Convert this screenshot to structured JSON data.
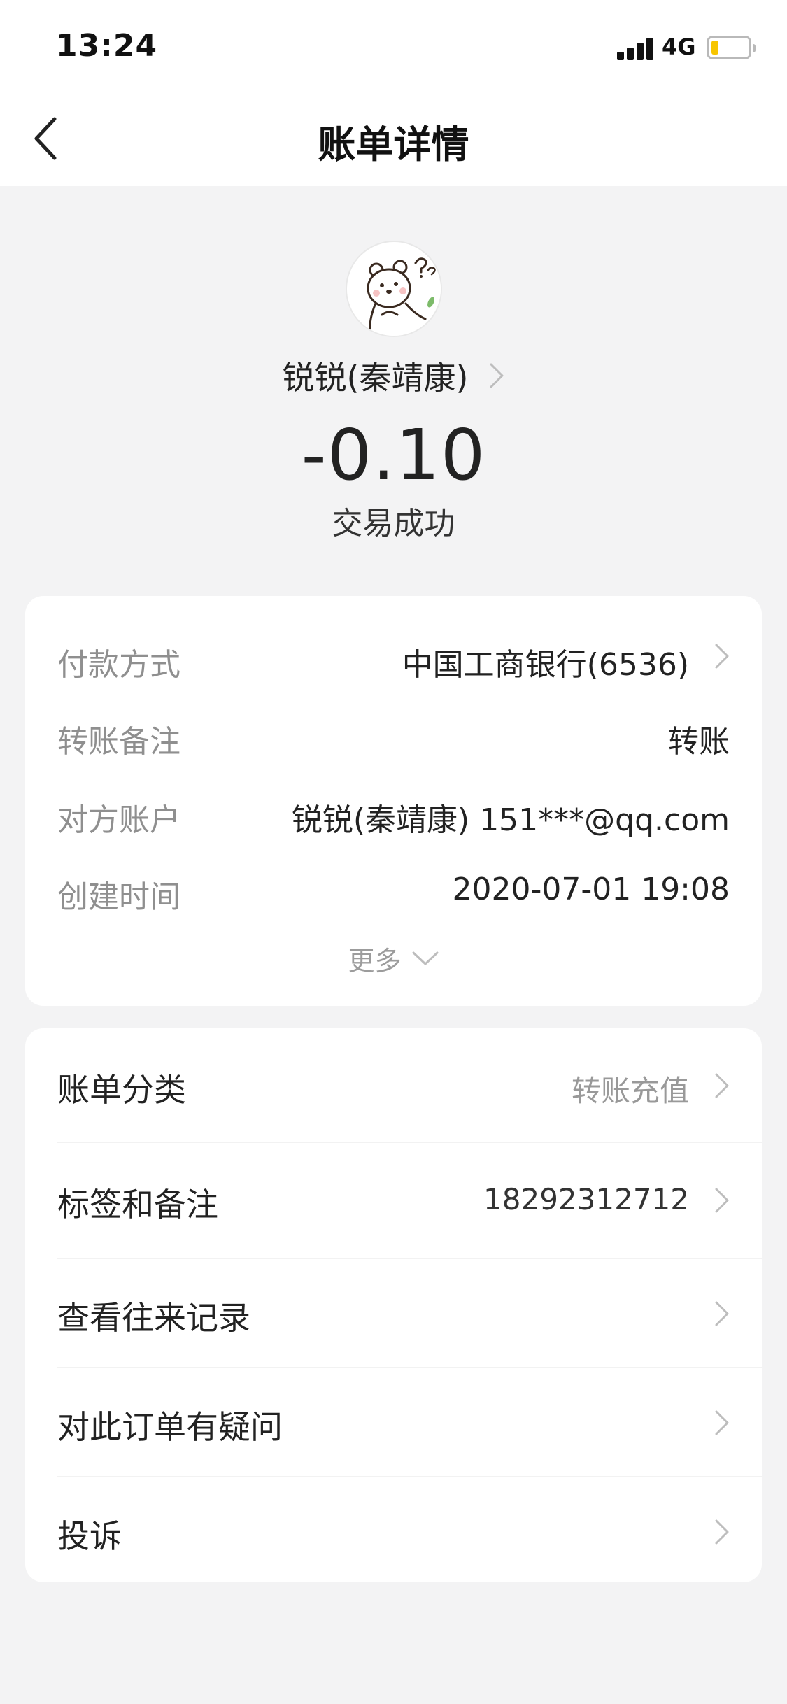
{
  "status_bar": {
    "time": "13:24",
    "network": "4G",
    "battery_level": 0.2,
    "battery_color": "#f7c500"
  },
  "nav": {
    "title": "账单详情",
    "back_icon": "chevron-left-icon"
  },
  "summary": {
    "payee_name": "锐锐(秦靖康)",
    "amount": "-0.10",
    "status": "交易成功"
  },
  "details": [
    {
      "label": "付款方式",
      "value": "中国工商银行(6536)",
      "has_arrow": true
    },
    {
      "label": "转账备注",
      "value": "转账",
      "has_arrow": false
    },
    {
      "label": "对方账户",
      "value": "锐锐(秦靖康) 151***@qq.com",
      "has_arrow": false
    },
    {
      "label": "创建时间",
      "value": "2020-07-01 19:08",
      "has_arrow": false
    }
  ],
  "more_label": "更多",
  "actions": [
    {
      "label": "账单分类",
      "value": "转账充值"
    },
    {
      "label": "标签和备注",
      "value": "18292312712"
    },
    {
      "label": "查看往来记录",
      "value": ""
    },
    {
      "label": "对此订单有疑问",
      "value": ""
    },
    {
      "label": "投诉",
      "value": ""
    }
  ]
}
